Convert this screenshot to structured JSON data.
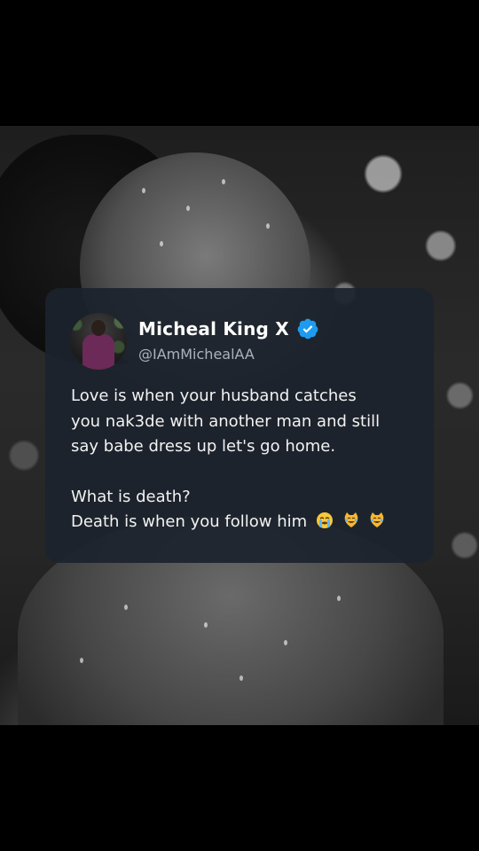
{
  "post": {
    "author_name": "Micheal King X",
    "author_handle": "@IAmMichealAA",
    "verified_icon": "verified-badge-icon",
    "avatar_icon": "profile-photo",
    "body_lines": [
      "Love is when your husband catches",
      "you nak3de with another man and still",
      "say babe dress up let's go home."
    ],
    "question": "What is death?",
    "answer": "Death is when you follow him",
    "emojis": [
      "loudly-crying-face",
      "cat-with-tears-of-joy",
      "cat-with-tears-of-joy"
    ]
  },
  "colors": {
    "card_background": "#1c232d",
    "verified_blue": "#1d9bf0",
    "handle_gray": "#aab3bd",
    "text_white": "#f2f2f2"
  }
}
